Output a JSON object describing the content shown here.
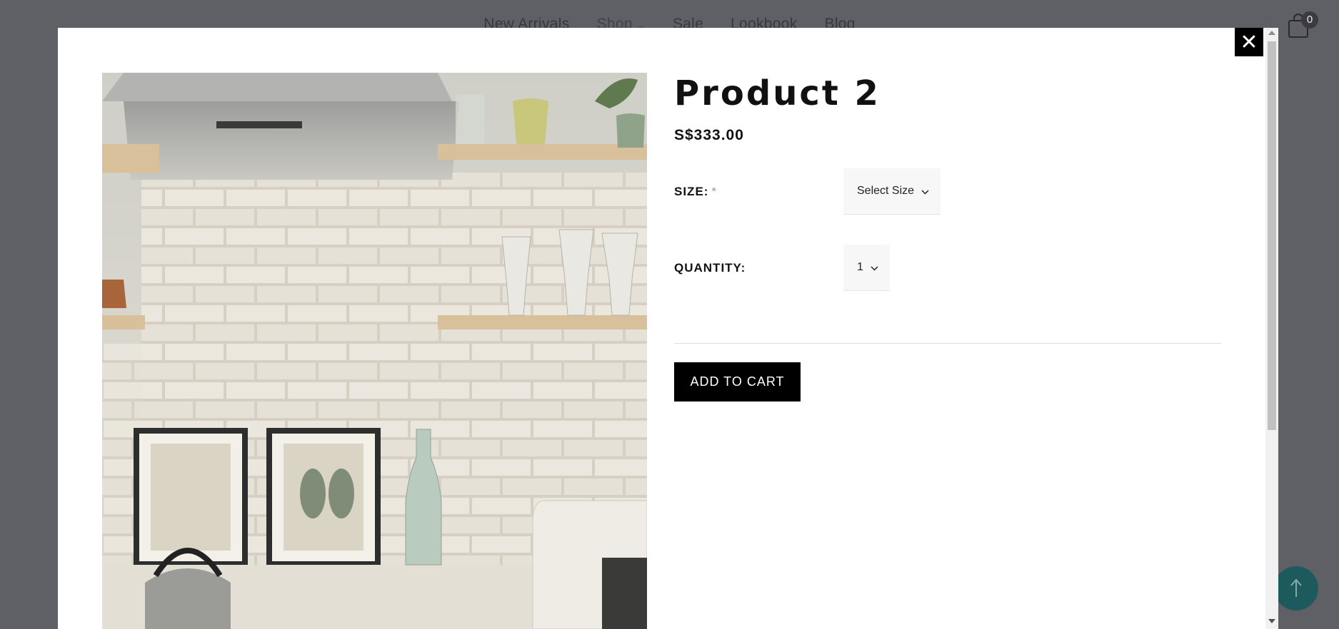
{
  "background_nav": {
    "items": [
      "New Arrivals",
      "Shop",
      "Sale",
      "Lookbook",
      "Blog"
    ]
  },
  "cart": {
    "count": "0",
    "icon": "shopping-bag-icon"
  },
  "modal": {
    "close_label": "✕",
    "product": {
      "title": "Product 2",
      "price": "S$333.00",
      "size_label": "SIZE:",
      "size_required_mark": "*",
      "size_selected": "Select Size",
      "quantity_label": "QUANTITY:",
      "quantity_selected": "1",
      "add_to_cart_label": "ADD TO CART"
    }
  },
  "colors": {
    "overlay": "#5f5f66",
    "modal_bg": "#ffffff",
    "primary_button": "#000000",
    "back_to_top": "#1d5a5e"
  },
  "icons": {
    "close": "close-icon",
    "chevron": "chevron-down-icon",
    "back_to_top": "arrow-up-icon"
  }
}
